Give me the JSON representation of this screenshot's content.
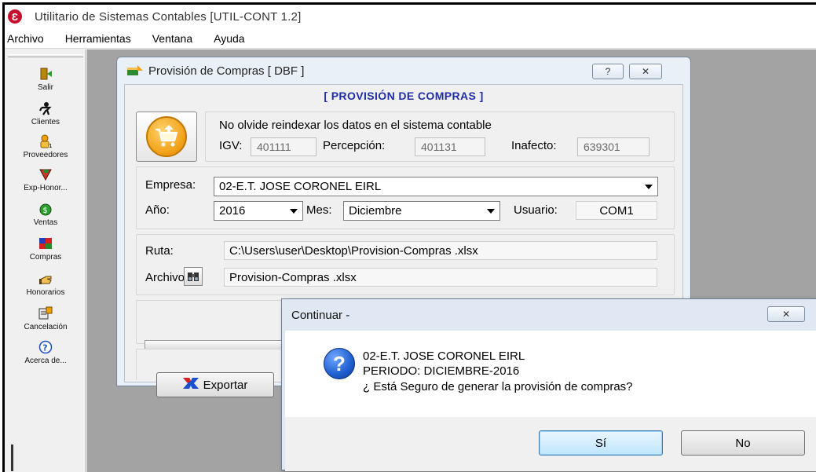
{
  "app": {
    "title": "Utilitario de Sistemas Contables [UTIL-CONT 1.2]",
    "icon_symbol": "Ɛ"
  },
  "menubar": {
    "items": [
      "Archivo",
      "Herramientas",
      "Ventana",
      "Ayuda"
    ]
  },
  "sidebar": {
    "items": [
      {
        "label": "Salir",
        "icon": "exit-door-icon"
      },
      {
        "label": "Clientes",
        "icon": "clients-person-icon"
      },
      {
        "label": "Proveedores",
        "icon": "suppliers-icon"
      },
      {
        "label": "Exp-Honor...",
        "icon": "exp-honorarios-icon"
      },
      {
        "label": "Ventas",
        "icon": "sales-money-icon"
      },
      {
        "label": "Compras",
        "icon": "purchases-icon"
      },
      {
        "label": "Honorarios",
        "icon": "fees-hand-icon"
      },
      {
        "label": "Cancelación",
        "icon": "cancellation-icon"
      },
      {
        "label": "Acerca de...",
        "icon": "about-help-icon"
      }
    ]
  },
  "provision_window": {
    "title": "Provisión de Compras [ DBF ]",
    "heading": "[ PROVISIÓN DE COMPRAS ]",
    "help_symbol": "?",
    "close_symbol": "✕",
    "notice": "No olvide reindexar los datos en el sistema contable",
    "igv_label": "IGV:",
    "igv_value": "401111",
    "percepcion_label": "Percepción:",
    "percepcion_value": "401131",
    "inafecto_label": "Inafecto:",
    "inafecto_value": "639301",
    "empresa_label": "Empresa:",
    "empresa_value": "02-E.T. JOSE CORONEL EIRL",
    "anio_label": "Año:",
    "anio_value": "2016",
    "mes_label": "Mes:",
    "mes_value": "Diciembre",
    "usuario_label": "Usuario:",
    "usuario_value": "COM1",
    "ruta_label": "Ruta:",
    "ruta_value": "C:\\Users\\user\\Desktop\\Provision-Compras .xlsx",
    "archivo_label": "Archivo:",
    "archivo_value": "Provision-Compras .xlsx",
    "export_label": "Exportar",
    "progress_fraction": 0
  },
  "dialog": {
    "title": "Continuar -",
    "close_symbol": "✕",
    "line1": "02-E.T. JOSE CORONEL EIRL",
    "line2": "PERIODO: DICIEMBRE-2016",
    "line3": "¿ Está Seguro de generar la provisión de compras?",
    "yes_label": "Sí",
    "no_label": "No"
  }
}
